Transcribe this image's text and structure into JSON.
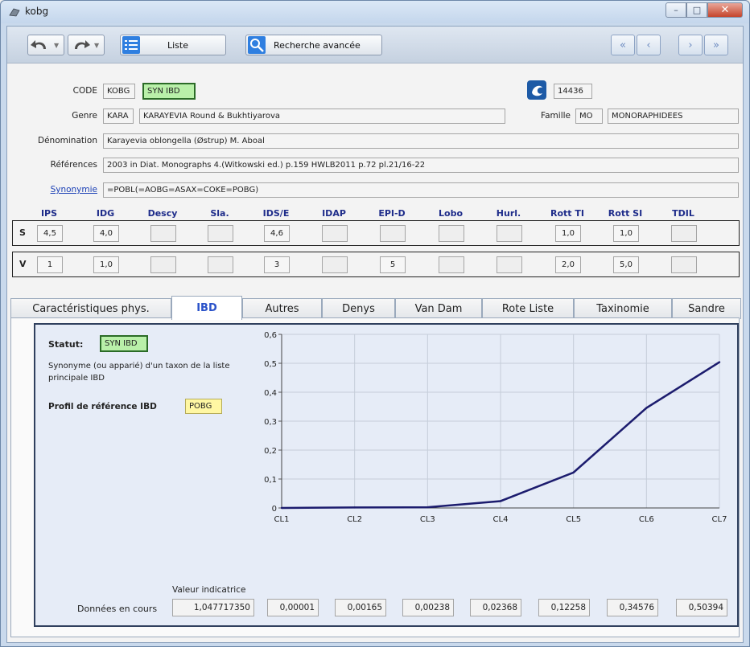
{
  "window": {
    "title": "kobg"
  },
  "toolbar": {
    "list_label": "Liste",
    "search_label": "Recherche avancée"
  },
  "form": {
    "code_label": "CODE",
    "code_value": "KOBG",
    "code_badge": "SYN IBD",
    "number_value": "14436",
    "genre_label": "Genre",
    "genre_code": "KARA",
    "genre_name": "KARAYEVIA Round & Bukhtiyarova",
    "famille_label": "Famille",
    "famille_code": "MO",
    "famille_name": "MONORAPHIDEES",
    "denomination_label": "Dénomination",
    "denomination_value": "Karayevia oblongella (Østrup) M. Aboal",
    "references_label": "Références",
    "references_value": "2003 in Diat. Monographs 4.(Witkowski ed.) p.159 HWLB2011 p.72 pl.21/16-22",
    "synonymie_label": "Synonymie",
    "synonymie_value": "=POBL(=AOBG=ASAX=COKE=POBG)"
  },
  "indices": {
    "headers": [
      "IPS",
      "IDG",
      "Descy",
      "Sla.",
      "IDS/E",
      "IDAP",
      "EPI-D",
      "Lobo",
      "Hurl.",
      "Rott TI",
      "Rott SI",
      "TDIL"
    ],
    "s_label": "S",
    "s_values": [
      "4,5",
      "4,0",
      "",
      "",
      "4,6",
      "",
      "",
      "",
      "",
      "1,0",
      "1,0",
      ""
    ],
    "v_label": "V",
    "v_values": [
      "1",
      "1,0",
      "",
      "",
      "3",
      "",
      "5",
      "",
      "",
      "2,0",
      "5,0",
      ""
    ]
  },
  "tabs": [
    "Caractéristiques phys.",
    "IBD",
    "Autres",
    "Denys",
    "Van Dam",
    "Rote Liste",
    "Taxinomie",
    "Sandre"
  ],
  "ibd": {
    "statut_label": "Statut:",
    "statut_badge": "SYN IBD",
    "description": "Synonyme (ou apparié) d'un taxon de la liste principale IBD",
    "profil_label": "Profil de référence IBD",
    "profil_value": "POBG",
    "valeur_label": "Valeur indicatrice",
    "donnees_label": "Données en cours",
    "donnees_value": "1,047717350",
    "class_values": [
      "0,00001",
      "0,00165",
      "0,00238",
      "0,02368",
      "0,12258",
      "0,34576",
      "0,50394"
    ]
  },
  "colors": {
    "line": "#1c1c6e",
    "badge_green": "#b9f0a9",
    "badge_yellow": "#fff7a3"
  },
  "chart_data": {
    "type": "line",
    "categories": [
      "CL1",
      "CL2",
      "CL3",
      "CL4",
      "CL5",
      "CL6",
      "CL7"
    ],
    "values": [
      1e-05,
      0.00165,
      0.00238,
      0.02368,
      0.12258,
      0.34576,
      0.50394
    ],
    "y_ticks": [
      "0",
      "0,1",
      "0,2",
      "0,3",
      "0,4",
      "0,5",
      "0,6"
    ],
    "ylim": [
      0,
      0.6
    ],
    "grid": true
  }
}
